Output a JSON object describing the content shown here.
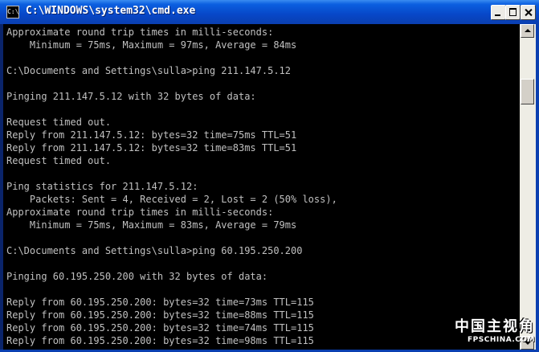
{
  "window": {
    "title": "C:\\WINDOWS\\system32\\cmd.exe",
    "icon": "cmd-icon"
  },
  "console": {
    "text": "Approximate round trip times in milli-seconds:\n    Minimum = 75ms, Maximum = 97ms, Average = 84ms\n\nC:\\Documents and Settings\\sulla>ping 211.147.5.12\n\nPinging 211.147.5.12 with 32 bytes of data:\n\nRequest timed out.\nReply from 211.147.5.12: bytes=32 time=75ms TTL=51\nReply from 211.147.5.12: bytes=32 time=83ms TTL=51\nRequest timed out.\n\nPing statistics for 211.147.5.12:\n    Packets: Sent = 4, Received = 2, Lost = 2 (50% loss),\nApproximate round trip times in milli-seconds:\n    Minimum = 75ms, Maximum = 83ms, Average = 79ms\n\nC:\\Documents and Settings\\sulla>ping 60.195.250.200\n\nPinging 60.195.250.200 with 32 bytes of data:\n\nReply from 60.195.250.200: bytes=32 time=73ms TTL=115\nReply from 60.195.250.200: bytes=32 time=88ms TTL=115\nReply from 60.195.250.200: bytes=32 time=74ms TTL=115\nReply from 60.195.250.200: bytes=32 time=98ms TTL=115"
  },
  "watermark": {
    "chinese": "中国主视角",
    "url": "FPSCHINA.COM"
  },
  "colors": {
    "titlebar": "#0a5fe0",
    "console_bg": "#000000",
    "console_fg": "#c0c0c0"
  }
}
